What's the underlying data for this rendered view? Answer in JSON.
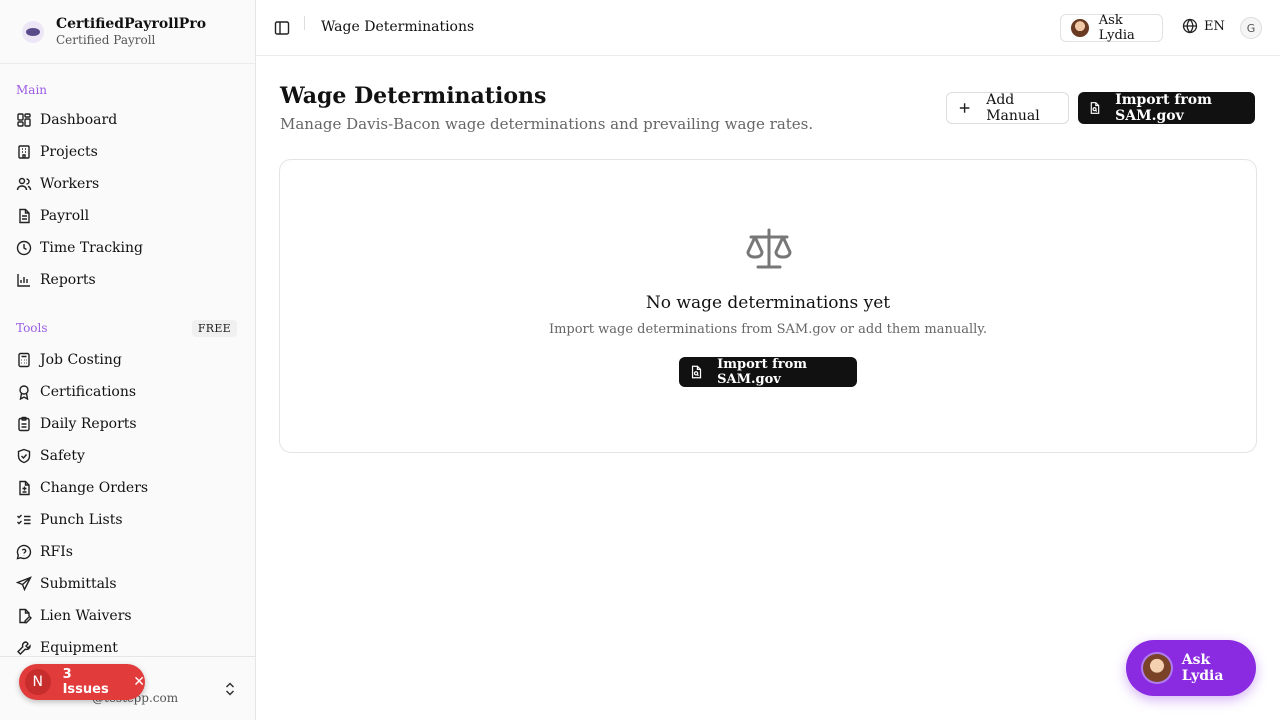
{
  "brand": {
    "name": "CertifiedPayrollPro",
    "subtitle": "Certified Payroll"
  },
  "sidebar": {
    "main_label": "Main",
    "main_items": [
      "Dashboard",
      "Projects",
      "Workers",
      "Payroll",
      "Time Tracking",
      "Reports"
    ],
    "tools_label": "Tools",
    "tools_badge": "FREE",
    "tools_items": [
      "Job Costing",
      "Certifications",
      "Daily Reports",
      "Safety",
      "Change Orders",
      "Punch Lists",
      "RFIs",
      "Submittals",
      "Lien Waivers",
      "Equipment"
    ],
    "user": {
      "name_partial": "pts",
      "email_partial": "@testcpp.com"
    }
  },
  "issues": {
    "initial": "N",
    "label": "3 Issues"
  },
  "topbar": {
    "title": "Wage Determinations",
    "ask_label": "Ask Lydia",
    "language": "EN",
    "user_initial": "G"
  },
  "main": {
    "title": "Wage Determinations",
    "subtitle": "Manage Davis-Bacon wage determinations and prevailing wage rates.",
    "add_manual_label": "Add Manual",
    "import_label": "Import from SAM.gov"
  },
  "empty_state": {
    "title": "No wage determinations yet",
    "subtitle": "Import wage determinations from SAM.gov or add them manually.",
    "button_label": "Import from SAM.gov"
  },
  "fab": {
    "label": "Ask Lydia"
  },
  "colors": {
    "accent": "#9b5de5",
    "fab": "#8a2be2",
    "issues": "#e23b3b",
    "primary_button": "#111111"
  }
}
